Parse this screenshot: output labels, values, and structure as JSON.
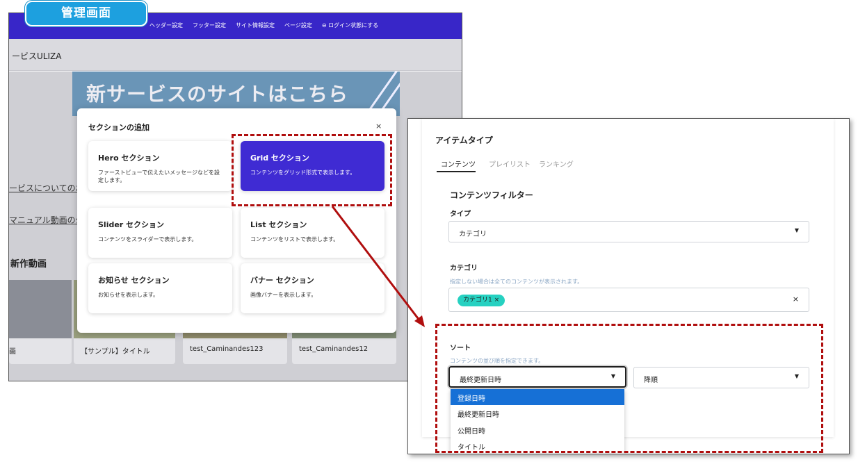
{
  "label_tab": "管理画面",
  "admin": {
    "nav_items": [
      "ヘッダー設定",
      "フッター設定",
      "サイト情報設定",
      "ページ設定",
      "⊖ ログイン状態にする"
    ],
    "site_name": "ービスULIZA",
    "banner_text": "新サービスのサイトはこちら",
    "links": [
      "ービスについてのお",
      "マニュアル動画の公"
    ],
    "new_videos_heading": "新作動画",
    "video_titles": [
      "画",
      "【サンプル】タイトル",
      "test_Caminandes123",
      "test_Caminandes12"
    ],
    "modal": {
      "title": "セクションの追加",
      "close": "×",
      "sections": [
        {
          "title": "Hero セクション",
          "desc": "ファーストビューで伝えたいメッセージなどを設定します。"
        },
        {
          "title": "Grid セクション",
          "desc": "コンテンツをグリッド形式で表示します。"
        },
        {
          "title": "Slider セクション",
          "desc": "コンテンツをスライダーで表示します。"
        },
        {
          "title": "List セクション",
          "desc": "コンテンツをリストで表示します。"
        },
        {
          "title": "お知らせ セクション",
          "desc": "お知らせを表示します。"
        },
        {
          "title": "バナー セクション",
          "desc": "画像バナーを表示します。"
        }
      ]
    }
  },
  "settings": {
    "item_type_label": "アイテムタイプ",
    "tabs": [
      "コンテンツ",
      "プレイリスト",
      "ランキング"
    ],
    "filter_heading": "コンテンツフィルター",
    "type_label": "タイプ",
    "type_value": "カテゴリ",
    "category_label": "カテゴリ",
    "category_hint": "指定しない場合は全てのコンテンツが表示されます。",
    "category_chip": "カテゴリ1 ×",
    "category_clear": "×",
    "sort_label": "ソート",
    "sort_hint": "コンテンツの並び順を指定できます。",
    "sort_value": "最終更新日時",
    "order_value": "降順",
    "sort_options": [
      "登録日時",
      "最終更新日時",
      "公開日時",
      "タイトル"
    ]
  },
  "colors": {
    "nav": "#3826c8",
    "active_card": "#3f2bd3",
    "label_tab": "#1da0df",
    "callout": "#b00e0e",
    "chip": "#26d1c1",
    "dropdown_highlight": "#1670d6"
  }
}
